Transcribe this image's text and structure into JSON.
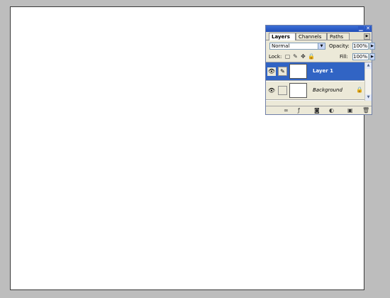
{
  "panel": {
    "tabs": [
      "Layers",
      "Channels",
      "Paths"
    ],
    "blend_mode": "Normal",
    "opacity_label": "Opacity:",
    "opacity_value": "100%",
    "lock_label": "Lock:",
    "fill_label": "Fill:",
    "fill_value": "100%",
    "layers": [
      {
        "name": "Layer 1",
        "selected": true
      },
      {
        "name": "Background",
        "selected": false,
        "locked": true
      }
    ],
    "icons": {
      "eye": "eye-icon",
      "brush": "brush-icon",
      "lock": "lock-icon",
      "move": "move-icon",
      "transparent": "checker-icon"
    }
  },
  "colors": {
    "workspace": "#bdbdbd",
    "selection": "#3164c4",
    "titlebar": "#2c58c4"
  }
}
